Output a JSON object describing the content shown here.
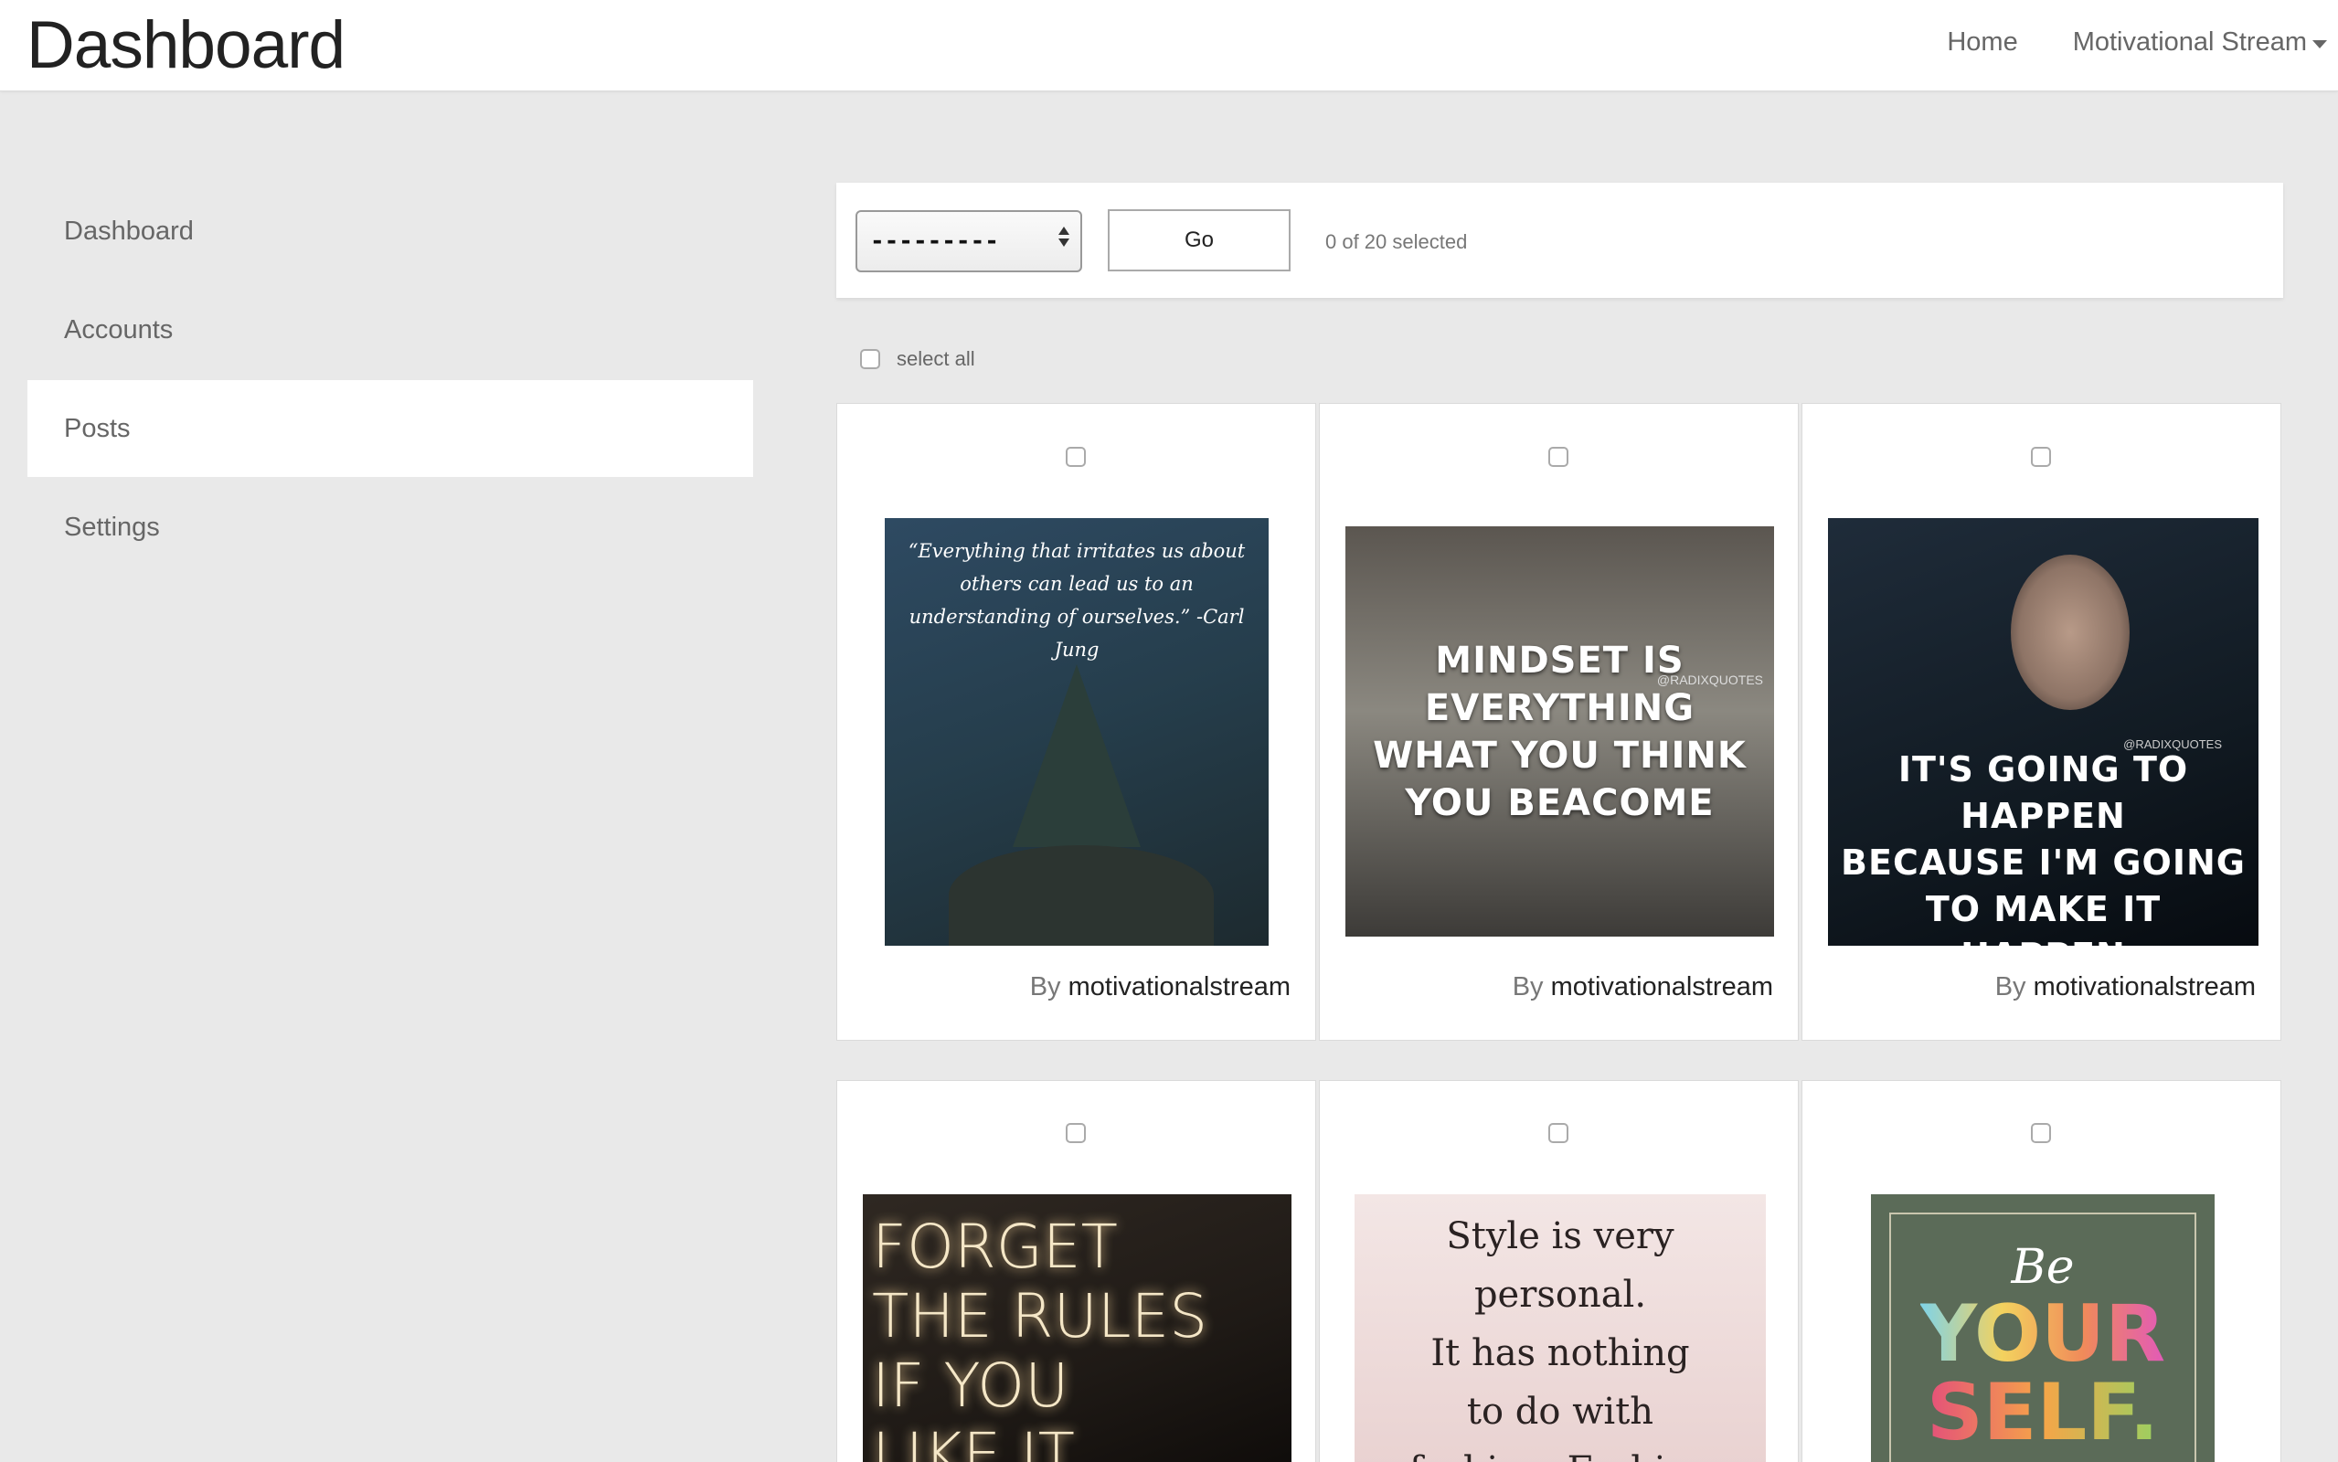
{
  "header": {
    "brand": "Dashboard",
    "nav_home": "Home",
    "nav_account": "Motivational Stream"
  },
  "sidebar": {
    "items": [
      {
        "label": "Dashboard",
        "active": false
      },
      {
        "label": "Accounts",
        "active": false
      },
      {
        "label": "Posts",
        "active": true
      },
      {
        "label": "Settings",
        "active": false
      }
    ]
  },
  "actions": {
    "select_value": "---------",
    "go_label": "Go",
    "selected_text": "0 of 20 selected",
    "select_all_label": "select all"
  },
  "posts": [
    {
      "image_text": "“Everything that irritates us about others can lead us to an understanding of ourselves.” -Carl Jung",
      "by_label": "By",
      "author": "motivationalstream"
    },
    {
      "image_lines": [
        "MINDSET IS EVERYTHING",
        "WHAT YOU THINK",
        "YOU BEACOME"
      ],
      "watermark": "@RADIXQUOTES",
      "by_label": "By",
      "author": "motivationalstream"
    },
    {
      "image_lines": [
        "IT'S GOING TO HAPPEN",
        "BECAUSE I'M GOING",
        "TO MAKE IT",
        "HAPPEN"
      ],
      "watermark": "@RADIXQUOTES",
      "by_label": "By",
      "author": "motivationalstream"
    },
    {
      "image_lines": [
        "FORGET",
        "THE RULES",
        "IF YOU",
        "LIKE IT"
      ]
    },
    {
      "image_lines": [
        "Style is very",
        "personal.",
        "It has nothing",
        "to do with",
        "fashion. Fashion"
      ]
    },
    {
      "image_lines": [
        "Be",
        "YOUR",
        "SELF."
      ]
    }
  ]
}
